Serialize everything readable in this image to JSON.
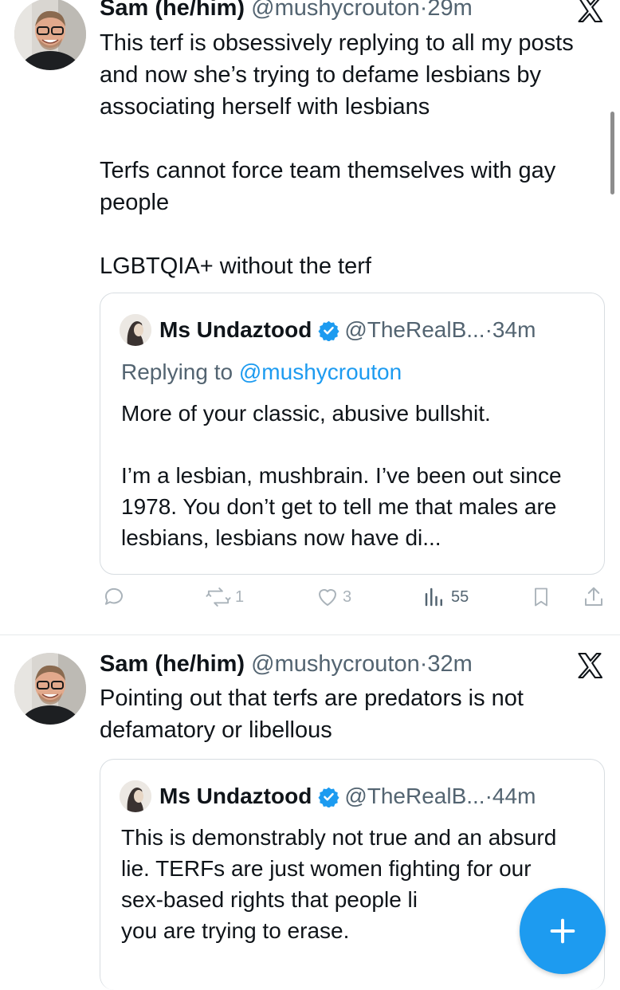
{
  "tweets": [
    {
      "author": {
        "name": "Sam (he/him)",
        "handle": "@mushycrouton",
        "separator": "·",
        "time": "29m"
      },
      "body": [
        "This terf is obsessively replying to all my posts and now she’s trying to defame lesbians by associating herself with lesbians",
        "Terfs cannot force team themselves with gay people",
        "LGBTQIA+ without the terf"
      ],
      "quote": {
        "name": "Ms Undaztood",
        "handle": "@TheRealB...",
        "separator": "·",
        "time": "34m",
        "replying_prefix": "Replying to",
        "replying_to": "@mushycrouton",
        "paragraphs": [
          "More of your classic, abusive bullshit.",
          "I’m a lesbian, mushbrain. I’ve been out since 1978. You don’t get to tell me that males are lesbians, lesbians now have di..."
        ]
      },
      "stats": {
        "retweets": "1",
        "likes": "3",
        "views": "55"
      }
    },
    {
      "author": {
        "name": "Sam (he/him)",
        "handle": "@mushycrouton",
        "separator": "·",
        "time": "32m"
      },
      "body": [
        "Pointing out that terfs are predators is not defamatory or libellous"
      ],
      "quote": {
        "name": "Ms Undaztood",
        "handle": "@TheRealB...",
        "separator": "·",
        "time": "44m",
        "paragraphs": [
          "This is demonstrably not true and an absurd lie. TERFs are just women fighting for our sex-based rights that people li",
          "you are trying to erase."
        ]
      }
    }
  ],
  "icons": {
    "platform": "x-logo-icon",
    "verified": "verified-badge-icon",
    "reply": "reply-icon",
    "retweet": "retweet-icon",
    "like": "heart-icon",
    "views": "views-chart-icon",
    "bookmark": "bookmark-icon",
    "share": "share-icon",
    "compose": "plus-icon"
  },
  "colors": {
    "accent": "#1d9bf0",
    "text": "#0f1419",
    "muted": "#536471",
    "border": "#d8dde1"
  }
}
